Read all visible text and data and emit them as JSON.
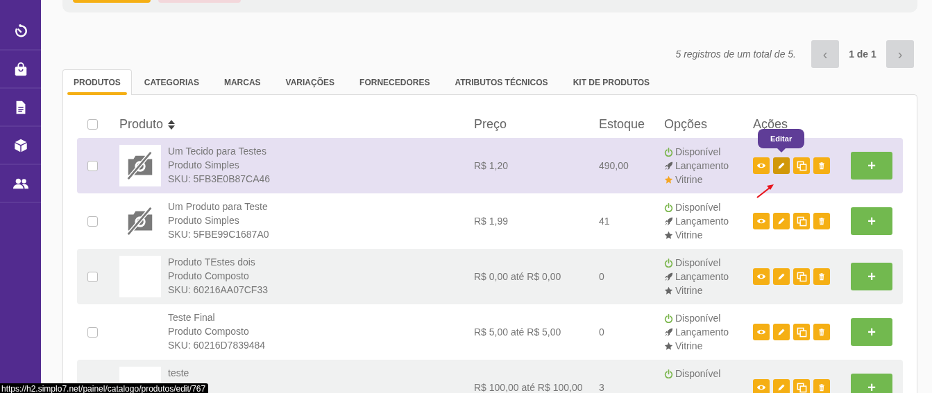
{
  "pagination": {
    "summary": "5 registros de um total de 5.",
    "page": "1 de 1",
    "buttons": [
      {
        "label": "‹",
        "disabled": true
      },
      {
        "label": "›",
        "disabled": true
      }
    ]
  },
  "tabs": [
    {
      "label": "PRODUTOS",
      "selected": true
    },
    {
      "label": "CATEGORIAS",
      "selected": false
    },
    {
      "label": "MARCAS",
      "selected": false
    },
    {
      "label": "VARIAÇÕES",
      "selected": false
    },
    {
      "label": "FORNECEDORES",
      "selected": false
    },
    {
      "label": "ATRIBUTOS TÉCNICOS",
      "selected": false
    },
    {
      "label": "KIT DE PRODUTOS",
      "selected": false
    }
  ],
  "table": {
    "select_all": {
      "checked": false
    },
    "columns": [
      {
        "label": "Produto",
        "sortable": true
      },
      {
        "label": "Preço",
        "sortable": false
      },
      {
        "label": "Estoque",
        "sortable": false
      },
      {
        "label": "Opções",
        "sortable": false
      },
      {
        "label": "Ações",
        "sortable": false
      }
    ],
    "rows": [
      {
        "checked": false,
        "hovered": true,
        "thumbnail": {
          "kind": "no-image"
        },
        "name": "Um Tecido para Testes",
        "type": "Produto Simples",
        "sku": "SKU: 5FB3E0B87CA46",
        "price": "R$ 1,20",
        "stock": "490,00",
        "options": [
          {
            "kind": "available",
            "label": "Disponível"
          },
          {
            "kind": "launch",
            "label": "Lançamento"
          },
          {
            "kind": "showcase",
            "label": "Vitrine",
            "on": true
          }
        ],
        "tooltip": "Editar",
        "add": "+"
      },
      {
        "checked": false,
        "hovered": false,
        "thumbnail": {
          "kind": "no-image"
        },
        "name": "Um Produto para Teste",
        "type": "Produto Simples",
        "sku": "SKU: 5FBE99C1687A0",
        "price": "R$ 1,99",
        "stock": "41",
        "options": [
          {
            "kind": "available",
            "label": "Disponível"
          },
          {
            "kind": "launch",
            "label": "Lançamento"
          },
          {
            "kind": "showcase",
            "label": "Vitrine",
            "on": false
          }
        ],
        "add": "+"
      },
      {
        "checked": false,
        "hovered": false,
        "thumbnail": {
          "kind": "blank"
        },
        "name": "Produto TEstes dois",
        "type": "Produto Composto",
        "sku": "SKU: 60216AA07CF33",
        "price": "R$ 0,00 até R$ 0,00",
        "stock": "0",
        "options": [
          {
            "kind": "available",
            "label": "Disponível"
          },
          {
            "kind": "launch",
            "label": "Lançamento"
          },
          {
            "kind": "showcase",
            "label": "Vitrine",
            "on": false
          }
        ],
        "add": "+"
      },
      {
        "checked": false,
        "hovered": false,
        "name": "Teste Final",
        "type": "Produto Composto",
        "sku": "SKU: 60216D7839484",
        "price": "R$ 5,00 até R$ 5,00",
        "stock": "0",
        "options": [
          {
            "kind": "available",
            "label": "Disponível"
          },
          {
            "kind": "launch",
            "label": "Lançamento"
          },
          {
            "kind": "showcase",
            "label": "Vitrine",
            "on": false
          }
        ],
        "add": "+"
      },
      {
        "hovered": false,
        "thumbnail": {
          "kind": "blank"
        },
        "name": "teste",
        "price": "R$ 100,00 até R$ 100,00",
        "stock": "3",
        "options": [
          {
            "kind": "available",
            "label": "Disponível"
          }
        ],
        "add": "+"
      }
    ]
  },
  "status_url": "https://h2.simplo7.net/painel/catalogo/produtos/edit/767"
}
